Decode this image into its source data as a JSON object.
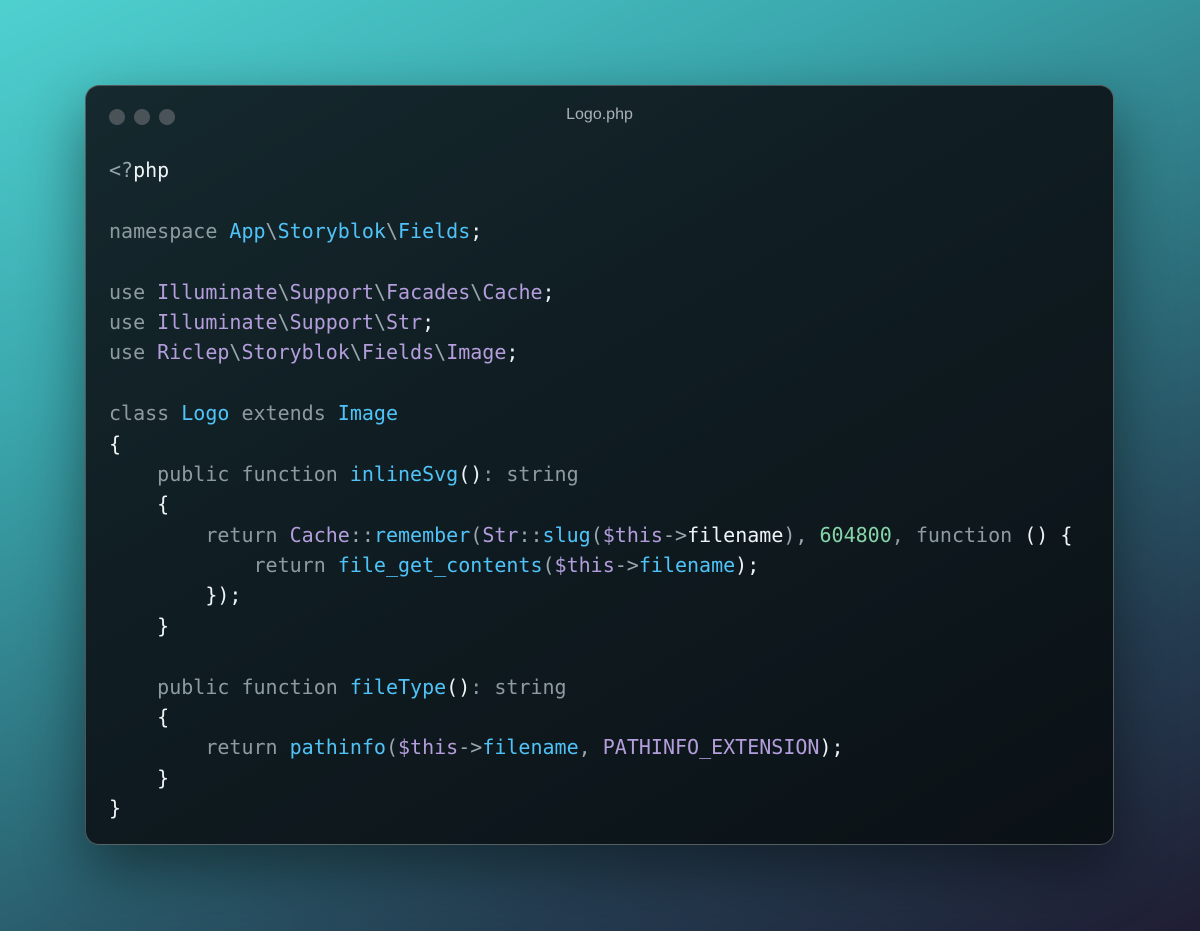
{
  "window": {
    "title": "Logo.php",
    "dots": [
      "close",
      "minimize",
      "maximize"
    ]
  },
  "colors": {
    "keyword": "#8d9aa0",
    "namespace": "#4fc3f7",
    "import": "#b39ddb",
    "function": "#4fc3f7",
    "variable": "#b39ddb",
    "number": "#86d4a7",
    "plain": "#eef4f6"
  },
  "code_lines": [
    [
      {
        "t": "<?",
        "c": "punct"
      },
      {
        "t": "php",
        "c": "plain"
      }
    ],
    [],
    [
      {
        "t": "namespace ",
        "c": "kw"
      },
      {
        "t": "App",
        "c": "ns"
      },
      {
        "t": "\\",
        "c": "punct"
      },
      {
        "t": "Storyblok",
        "c": "ns"
      },
      {
        "t": "\\",
        "c": "punct"
      },
      {
        "t": "Fields",
        "c": "ns"
      },
      {
        "t": ";",
        "c": "plain"
      }
    ],
    [],
    [
      {
        "t": "use ",
        "c": "kw"
      },
      {
        "t": "Illuminate",
        "c": "use"
      },
      {
        "t": "\\",
        "c": "punct"
      },
      {
        "t": "Support",
        "c": "use"
      },
      {
        "t": "\\",
        "c": "punct"
      },
      {
        "t": "Facades",
        "c": "use"
      },
      {
        "t": "\\",
        "c": "punct"
      },
      {
        "t": "Cache",
        "c": "use"
      },
      {
        "t": ";",
        "c": "plain"
      }
    ],
    [
      {
        "t": "use ",
        "c": "kw"
      },
      {
        "t": "Illuminate",
        "c": "use"
      },
      {
        "t": "\\",
        "c": "punct"
      },
      {
        "t": "Support",
        "c": "use"
      },
      {
        "t": "\\",
        "c": "punct"
      },
      {
        "t": "Str",
        "c": "use"
      },
      {
        "t": ";",
        "c": "plain"
      }
    ],
    [
      {
        "t": "use ",
        "c": "kw"
      },
      {
        "t": "Riclep",
        "c": "use"
      },
      {
        "t": "\\",
        "c": "punct"
      },
      {
        "t": "Storyblok",
        "c": "use"
      },
      {
        "t": "\\",
        "c": "punct"
      },
      {
        "t": "Fields",
        "c": "use"
      },
      {
        "t": "\\",
        "c": "punct"
      },
      {
        "t": "Image",
        "c": "use"
      },
      {
        "t": ";",
        "c": "plain"
      }
    ],
    [],
    [
      {
        "t": "class ",
        "c": "kw"
      },
      {
        "t": "Logo",
        "c": "class"
      },
      {
        "t": " extends ",
        "c": "kw"
      },
      {
        "t": "Image",
        "c": "class"
      }
    ],
    [
      {
        "t": "{",
        "c": "plain"
      }
    ],
    [
      {
        "t": "    public function ",
        "c": "kw"
      },
      {
        "t": "inlineSvg",
        "c": "fn"
      },
      {
        "t": "()",
        "c": "plain"
      },
      {
        "t": ": string",
        "c": "kw"
      }
    ],
    [
      {
        "t": "    {",
        "c": "plain"
      }
    ],
    [
      {
        "t": "        return ",
        "c": "kw"
      },
      {
        "t": "Cache",
        "c": "use"
      },
      {
        "t": "::",
        "c": "punct"
      },
      {
        "t": "remember",
        "c": "fn"
      },
      {
        "t": "(",
        "c": "punct"
      },
      {
        "t": "Str",
        "c": "use"
      },
      {
        "t": "::",
        "c": "punct"
      },
      {
        "t": "slug",
        "c": "fn"
      },
      {
        "t": "(",
        "c": "punct"
      },
      {
        "t": "$this",
        "c": "var"
      },
      {
        "t": "->",
        "c": "punct"
      },
      {
        "t": "filename",
        "c": "plain"
      },
      {
        "t": "), ",
        "c": "punct"
      },
      {
        "t": "604800",
        "c": "num"
      },
      {
        "t": ", function ",
        "c": "kw"
      },
      {
        "t": "() {",
        "c": "plain"
      }
    ],
    [
      {
        "t": "            return ",
        "c": "kw"
      },
      {
        "t": "file_get_contents",
        "c": "fn"
      },
      {
        "t": "(",
        "c": "punct"
      },
      {
        "t": "$this",
        "c": "var"
      },
      {
        "t": "->",
        "c": "punct"
      },
      {
        "t": "filename",
        "c": "fn"
      },
      {
        "t": ");",
        "c": "plain"
      }
    ],
    [
      {
        "t": "        });",
        "c": "plain"
      }
    ],
    [
      {
        "t": "    }",
        "c": "plain"
      }
    ],
    [],
    [
      {
        "t": "    public function ",
        "c": "kw"
      },
      {
        "t": "fileType",
        "c": "fn"
      },
      {
        "t": "()",
        "c": "plain"
      },
      {
        "t": ": string",
        "c": "kw"
      }
    ],
    [
      {
        "t": "    {",
        "c": "plain"
      }
    ],
    [
      {
        "t": "        return ",
        "c": "kw"
      },
      {
        "t": "pathinfo",
        "c": "fn"
      },
      {
        "t": "(",
        "c": "punct"
      },
      {
        "t": "$this",
        "c": "var"
      },
      {
        "t": "->",
        "c": "punct"
      },
      {
        "t": "filename",
        "c": "fn"
      },
      {
        "t": ", ",
        "c": "punct"
      },
      {
        "t": "PATHINFO_EXTENSION",
        "c": "const"
      },
      {
        "t": ");",
        "c": "plain"
      }
    ],
    [
      {
        "t": "    }",
        "c": "plain"
      }
    ],
    [
      {
        "t": "}",
        "c": "plain"
      }
    ]
  ]
}
